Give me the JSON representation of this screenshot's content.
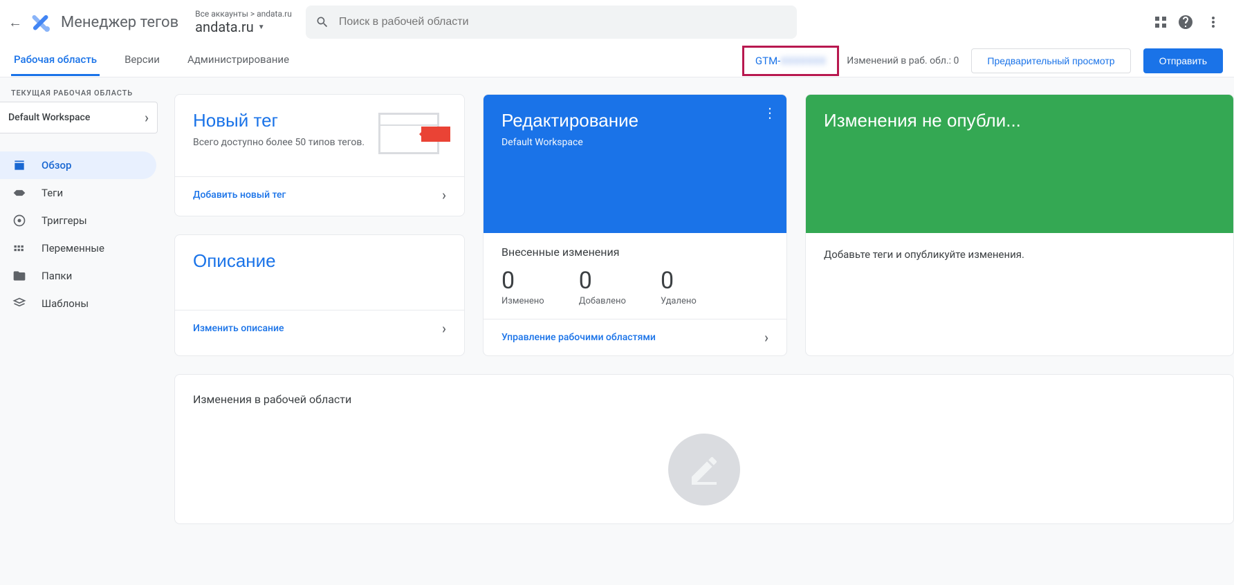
{
  "header": {
    "app_title": "Менеджер тегов",
    "account_crumb": "Все аккаунты > andata.ru",
    "account_name": "andata.ru",
    "search_placeholder": "Поиск в рабочей области"
  },
  "nav": {
    "tabs": {
      "workspace": "Рабочая область",
      "versions": "Версии",
      "admin": "Администрирование"
    },
    "container_prefix": "GTM-",
    "container_blur": "XXXXXXX",
    "changes_label": "Изменений в раб. обл.: 0",
    "preview_btn": "Предварительный просмотр",
    "submit_btn": "Отправить"
  },
  "sidebar": {
    "ws_label": "ТЕКУЩАЯ РАБОЧАЯ ОБЛАСТЬ",
    "ws_name": "Default Workspace",
    "items": {
      "overview": "Обзор",
      "tags": "Теги",
      "triggers": "Триггеры",
      "variables": "Переменные",
      "folders": "Папки",
      "templates": "Шаблоны"
    }
  },
  "cards": {
    "new_tag": {
      "title": "Новый тег",
      "sub": "Всего доступно более 50 типов тегов.",
      "action": "Добавить новый тег"
    },
    "description": {
      "title": "Описание",
      "action": "Изменить описание"
    },
    "editing": {
      "title": "Редактирование",
      "sub": "Default Workspace",
      "stats_title": "Внесенные изменения",
      "changed_n": "0",
      "changed_l": "Изменено",
      "added_n": "0",
      "added_l": "Добавлено",
      "deleted_n": "0",
      "deleted_l": "Удалено",
      "action": "Управление рабочими областями"
    },
    "publish": {
      "title": "Изменения не опубли...",
      "body": "Добавьте теги и опубликуйте изменения."
    }
  },
  "ws_changes": {
    "title": "Изменения в рабочей области"
  }
}
